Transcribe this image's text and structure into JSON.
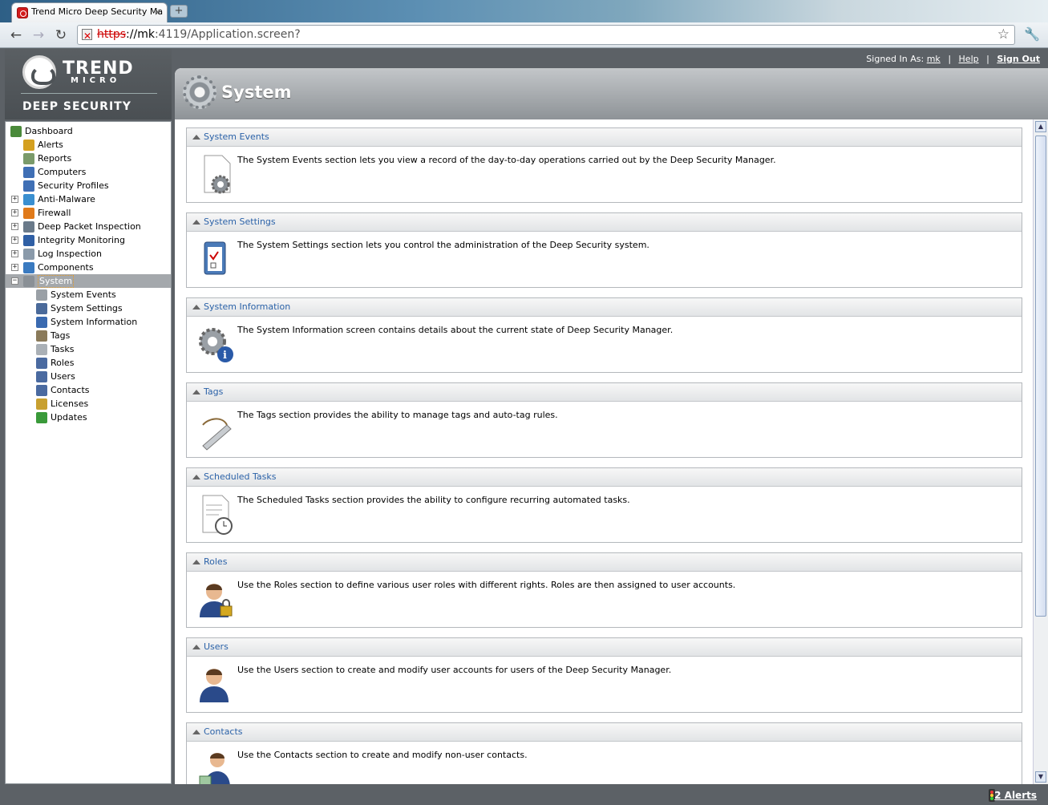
{
  "browser": {
    "tab_title": "Trend Micro Deep Security Ma",
    "tab_close": "×",
    "new_tab": "+",
    "url_protocol": "https",
    "url_host": "://mk",
    "url_rest": ":4119/Application.screen?",
    "back_glyph": "←",
    "forward_glyph": "→",
    "reload_glyph": "↻",
    "star_glyph": "☆",
    "wrench_glyph": "🔧"
  },
  "brand": {
    "trend": "TREND",
    "micro": "MICRO",
    "product": "DEEP SECURITY"
  },
  "header": {
    "signed_in_label": "Signed In As:",
    "user": "mk",
    "sep1": "|",
    "help": "Help",
    "sep2": "|",
    "sign_out": "Sign Out"
  },
  "sidebar": {
    "items": [
      {
        "label": "Dashboard",
        "icon": "dashboard-icon",
        "color": "#4a8a3a"
      },
      {
        "label": "Alerts",
        "icon": "alerts-icon",
        "color": "#d4a020"
      },
      {
        "label": "Reports",
        "icon": "reports-icon",
        "color": "#7a9a6a"
      },
      {
        "label": "Computers",
        "icon": "computers-icon",
        "color": "#3f6fb5"
      },
      {
        "label": "Security Profiles",
        "icon": "security-profiles-icon",
        "color": "#3f6fb5"
      },
      {
        "label": "Anti-Malware",
        "icon": "anti-malware-icon",
        "color": "#3a8fd0"
      },
      {
        "label": "Firewall",
        "icon": "firewall-icon",
        "color": "#e07a1a"
      },
      {
        "label": "Deep Packet Inspection",
        "icon": "deep-packet-inspection-icon",
        "color": "#6a7a8a"
      },
      {
        "label": "Integrity Monitoring",
        "icon": "integrity-monitoring-icon",
        "color": "#2f5fa5"
      },
      {
        "label": "Log Inspection",
        "icon": "log-inspection-icon",
        "color": "#8a9aaa"
      },
      {
        "label": "Components",
        "icon": "components-icon",
        "color": "#3a7ac0"
      },
      {
        "label": "System",
        "icon": "system-icon",
        "color": "#8a9096"
      },
      {
        "label": "System Events",
        "icon": "system-events-icon",
        "color": "#9aa0a6"
      },
      {
        "label": "System Settings",
        "icon": "system-settings-icon",
        "color": "#4a6a9a"
      },
      {
        "label": "System Information",
        "icon": "system-information-icon",
        "color": "#3a6ab0"
      },
      {
        "label": "Tags",
        "icon": "tags-icon",
        "color": "#8a7a5a"
      },
      {
        "label": "Tasks",
        "icon": "tasks-icon",
        "color": "#aab0b6"
      },
      {
        "label": "Roles",
        "icon": "roles-icon",
        "color": "#4a6aa0"
      },
      {
        "label": "Users",
        "icon": "users-icon",
        "color": "#4a6aa0"
      },
      {
        "label": "Contacts",
        "icon": "contacts-icon",
        "color": "#4a6aa0"
      },
      {
        "label": "Licenses",
        "icon": "licenses-icon",
        "color": "#c8a030"
      },
      {
        "label": "Updates",
        "icon": "updates-icon",
        "color": "#3a9a3a"
      }
    ]
  },
  "page": {
    "title": "System"
  },
  "panels": [
    {
      "title": "System Events",
      "desc": "The System Events section lets you view a record of the day-to-day operations carried out by the Deep Security Manager.",
      "icon": "system-events-page-gear-icon"
    },
    {
      "title": "System Settings",
      "desc": "The System Settings section lets you control the administration of the Deep Security system.",
      "icon": "clipboard-checklist-icon"
    },
    {
      "title": "System Information",
      "desc": "The System Information screen contains details about the current state of Deep Security Manager.",
      "icon": "gear-info-icon"
    },
    {
      "title": "Tags",
      "desc": "The Tags section provides the ability to manage tags and auto-tag rules.",
      "icon": "tag-icon"
    },
    {
      "title": "Scheduled Tasks",
      "desc": "The Scheduled Tasks section provides the ability to configure recurring automated tasks.",
      "icon": "document-clock-icon"
    },
    {
      "title": "Roles",
      "desc": "Use the Roles section to define various user roles with different rights. Roles are then assigned to user accounts.",
      "icon": "user-lock-icon"
    },
    {
      "title": "Users",
      "desc": "Use the Users section to create and modify user accounts for users of the Deep Security Manager.",
      "icon": "user-icon"
    },
    {
      "title": "Contacts",
      "desc": "Use the Contacts section to create and modify non-user contacts.",
      "icon": "contact-icon"
    }
  ],
  "status": {
    "alerts": "2 Alerts"
  }
}
